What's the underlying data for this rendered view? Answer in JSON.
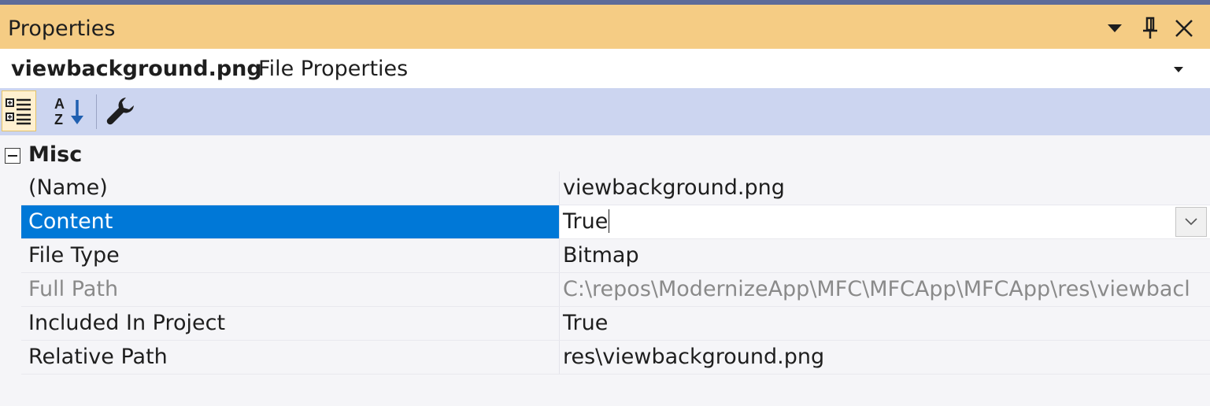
{
  "window": {
    "title": "Properties",
    "colors": {
      "title_bar": "#f5cc84",
      "toolbar": "#ccd5f0",
      "selection": "#0078d7",
      "top_strip": "#5d6b99"
    }
  },
  "title_buttons": [
    {
      "icon": "dropdown-triangle-icon"
    },
    {
      "icon": "pin-icon"
    },
    {
      "icon": "close-icon"
    }
  ],
  "object_selector": {
    "name": "viewbackground.png",
    "type": "File Properties"
  },
  "toolbar": {
    "buttons": [
      {
        "icon": "categorized-icon",
        "active": true
      },
      {
        "icon": "alphabetical-icon",
        "active": false
      },
      {
        "icon": "property-pages-wrench-icon",
        "active": false
      }
    ]
  },
  "grid": {
    "category": {
      "label": "Misc",
      "expanded": true
    },
    "properties": [
      {
        "name": "(Name)",
        "value": "viewbackground.png"
      },
      {
        "name": "Content",
        "value": "True",
        "selected": true
      },
      {
        "name": "File Type",
        "value": "Bitmap"
      },
      {
        "name": "Full Path",
        "value": "C:\\repos\\ModernizeApp\\MFC\\MFCApp\\MFCApp\\res\\viewbacl",
        "readonly": true
      },
      {
        "name": "Included In Project",
        "value": "True"
      },
      {
        "name": "Relative Path",
        "value": "res\\viewbackground.png"
      }
    ]
  }
}
